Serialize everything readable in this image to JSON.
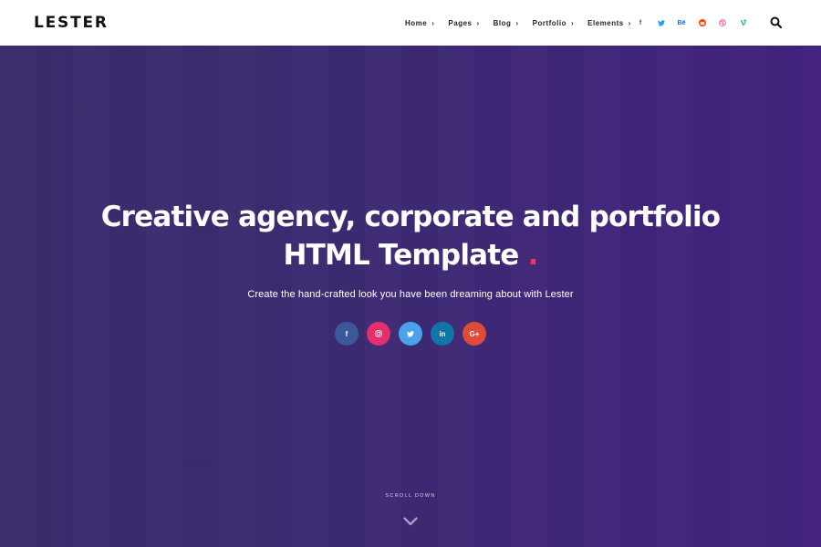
{
  "brand": {
    "logo": "LESTER"
  },
  "nav": {
    "items": [
      {
        "label": "Home"
      },
      {
        "label": "Pages"
      },
      {
        "label": "Blog"
      },
      {
        "label": "Portfolio"
      },
      {
        "label": "Elements"
      }
    ]
  },
  "header_social": [
    {
      "icon": "facebook-icon",
      "glyph": "f",
      "color": "#3b5998"
    },
    {
      "icon": "twitter-icon",
      "glyph": "t",
      "color": "#1da1f2"
    },
    {
      "icon": "behance-icon",
      "glyph": "Bē",
      "color": "#1769ff"
    },
    {
      "icon": "reddit-icon",
      "glyph": "r",
      "color": "#ff4500"
    },
    {
      "icon": "dribbble-icon",
      "glyph": "◎",
      "color": "#ea4c89"
    },
    {
      "icon": "vine-icon",
      "glyph": "v",
      "color": "#00b488"
    }
  ],
  "hero": {
    "title_line1": "Creative agency, corporate and portfolio",
    "title_line2": "HTML Template",
    "title_dot": ".",
    "subtitle": "Create the hand-crafted look you have been dreaming about with Lester",
    "social": [
      {
        "icon": "facebook-icon",
        "glyph": "f",
        "color": "#3b5998"
      },
      {
        "icon": "instagram-icon",
        "glyph": "◎",
        "color": "#e1306c"
      },
      {
        "icon": "twitter-icon",
        "glyph": "t",
        "color": "#4aa3e8"
      },
      {
        "icon": "linkedin-icon",
        "glyph": "in",
        "color": "#0e76a8"
      },
      {
        "icon": "google-plus-icon",
        "glyph": "G+",
        "color": "#dd4b39"
      }
    ],
    "scroll_label": "SCROLL DOWN"
  },
  "colors": {
    "accent": "#e8356b",
    "hero_gradient_start": "#3b2c6c",
    "hero_gradient_end": "#42227e"
  }
}
